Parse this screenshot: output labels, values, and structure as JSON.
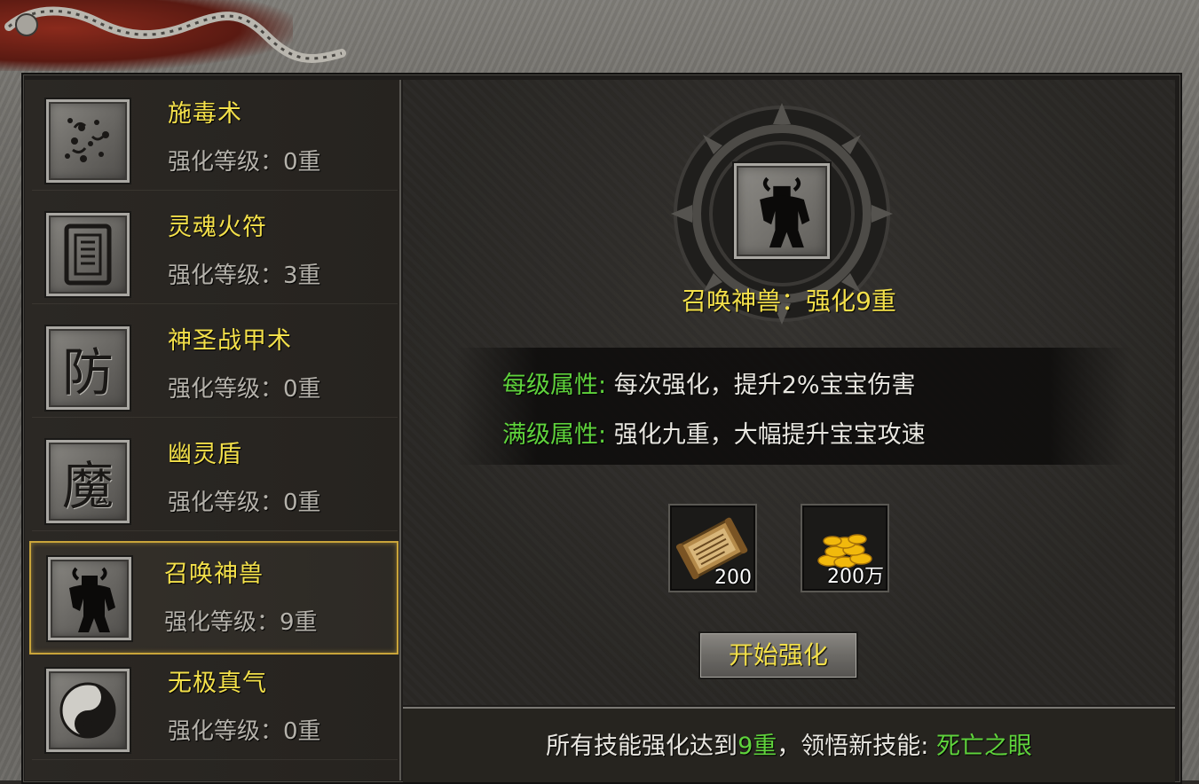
{
  "skills": [
    {
      "name": "施毒术",
      "level": "强化等级：0重",
      "icon": "poison-icon"
    },
    {
      "name": "灵魂火符",
      "level": "强化等级：3重",
      "icon": "talisman-icon"
    },
    {
      "name": "神圣战甲术",
      "level": "强化等级：0重",
      "icon": "defense-glyph-icon",
      "glyph": "防"
    },
    {
      "name": "幽灵盾",
      "level": "强化等级：0重",
      "icon": "demon-glyph-icon",
      "glyph": "魔"
    },
    {
      "name": "召唤神兽",
      "level": "强化等级：9重",
      "icon": "beast-icon",
      "selected": true
    },
    {
      "name": "无极真气",
      "level": "强化等级：0重",
      "icon": "yin-yang-icon"
    }
  ],
  "detail": {
    "title": "召唤神兽：强化9重",
    "per_level_label": "每级属性:",
    "per_level_value": "每次强化，提升2%宝宝伤害",
    "max_level_label": "满级属性:",
    "max_level_value": "强化九重，大幅提升宝宝攻速"
  },
  "costs": [
    {
      "item": "skill-book-icon",
      "count": "200"
    },
    {
      "item": "gold-coins-icon",
      "count": "200万"
    }
  ],
  "start_button": "开始强化",
  "footer": {
    "prefix": "所有技能强化达到",
    "target": "9重",
    "middle": "，领悟新技能: ",
    "reward": "死亡之眼"
  },
  "colors": {
    "skill_name": "#f3e04a",
    "attr_label": "#5fd33c",
    "selected_border": "#c9a43a"
  }
}
